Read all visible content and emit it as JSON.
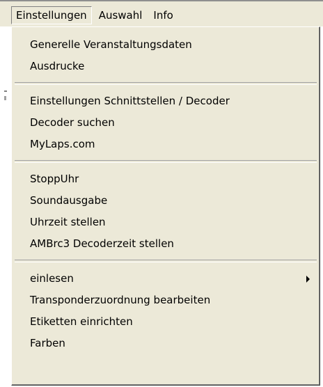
{
  "menubar": {
    "items": [
      {
        "label": "Einstellungen"
      },
      {
        "label": "Auswahl"
      },
      {
        "label": "Info"
      }
    ]
  },
  "dropdown": {
    "group1": [
      {
        "label": "Generelle Veranstaltungsdaten"
      },
      {
        "label": "Ausdrucke"
      }
    ],
    "group2": [
      {
        "label": "Einstellungen Schnittstellen / Decoder"
      },
      {
        "label": "Decoder suchen"
      },
      {
        "label": "MyLaps.com"
      }
    ],
    "group3": [
      {
        "label": "StoppUhr"
      },
      {
        "label": "Soundausgabe"
      },
      {
        "label": "Uhrzeit stellen"
      },
      {
        "label": "AMBrc3 Decoderzeit stellen"
      }
    ],
    "group4": [
      {
        "label": "einlesen",
        "submenu": true,
        "submenu_icon": "triangle-right-icon"
      },
      {
        "label": "Transponderzuordnung bearbeiten"
      },
      {
        "label": "Etiketten einrichten"
      },
      {
        "label": "Farben"
      }
    ]
  }
}
